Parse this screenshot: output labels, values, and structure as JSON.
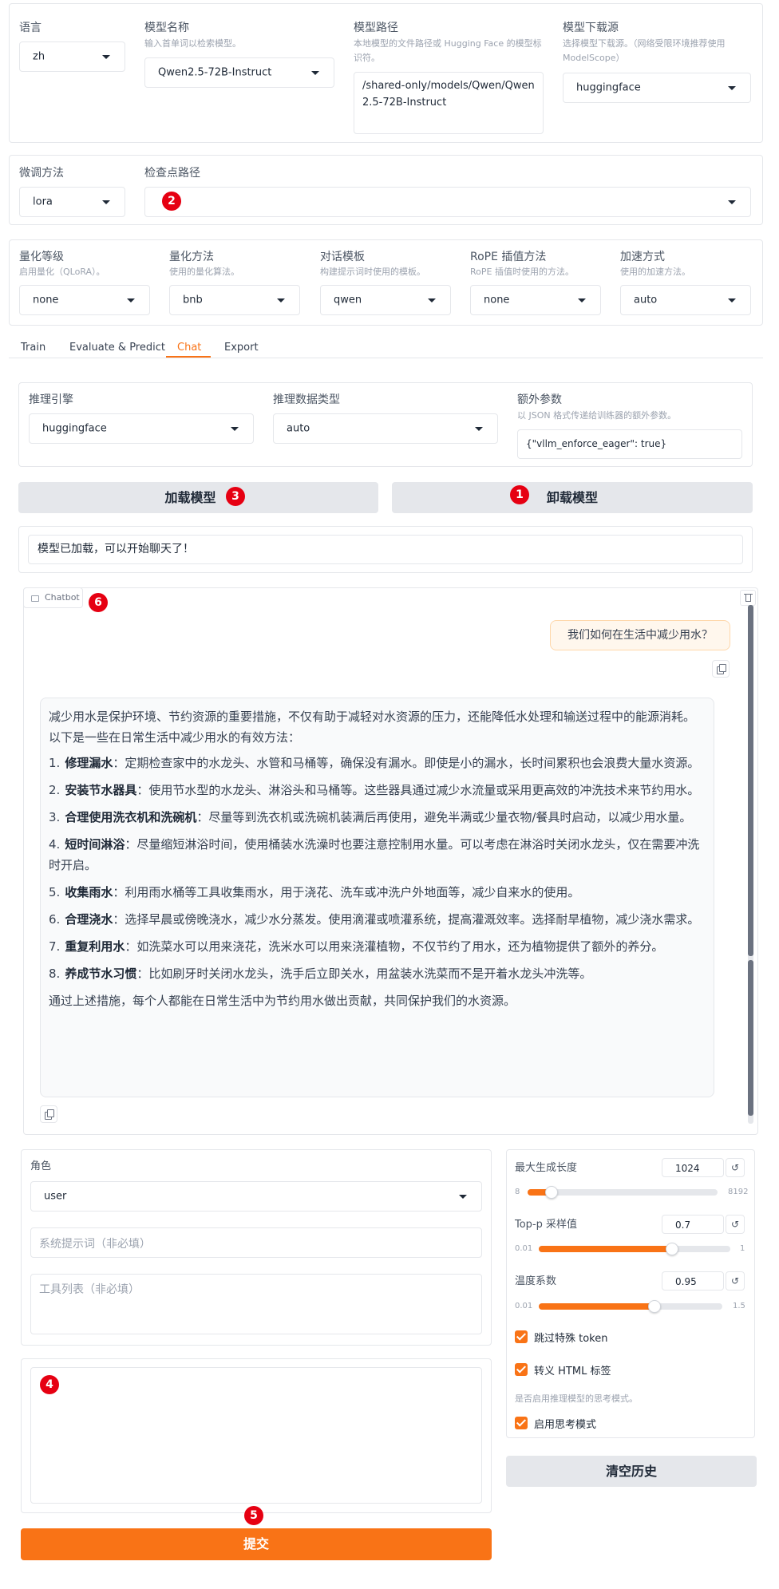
{
  "top_row": {
    "language": {
      "label": "语言",
      "value": "zh"
    },
    "model_name": {
      "label": "模型名称",
      "info": "输入首单词以检索模型。",
      "value": "Qwen2.5-72B-Instruct"
    },
    "model_path": {
      "label": "模型路径",
      "info": "本地模型的文件路径或 Hugging Face 的模型标识符。",
      "value": "/shared-only/models/Qwen/Qwen2.5-72B-Instruct"
    },
    "hub": {
      "label": "模型下载源",
      "info": "选择模型下载源。（网络受限环境推荐使用 ModelScope）",
      "value": "huggingface"
    }
  },
  "finetune_row": {
    "method": {
      "label": "微调方法",
      "value": "lora"
    },
    "checkpoint": {
      "label": "检查点路径",
      "value": ""
    }
  },
  "quant_row": {
    "quant_bit": {
      "label": "量化等级",
      "info": "启用量化（QLoRA）。",
      "value": "none"
    },
    "quant_method": {
      "label": "量化方法",
      "info": "使用的量化算法。",
      "value": "bnb"
    },
    "template": {
      "label": "对话模板",
      "info": "构建提示词时使用的模板。",
      "value": "qwen"
    },
    "rope": {
      "label": "RoPE 插值方法",
      "info": "RoPE 插值时使用的方法。",
      "value": "none"
    },
    "booster": {
      "label": "加速方式",
      "info": "使用的加速方法。",
      "value": "auto"
    }
  },
  "tabs": [
    {
      "label": "Train",
      "active": false
    },
    {
      "label": "Evaluate & Predict",
      "active": false
    },
    {
      "label": "Chat",
      "active": true
    },
    {
      "label": "Export",
      "active": false
    }
  ],
  "infer": {
    "backend": {
      "label": "推理引擎",
      "value": "huggingface"
    },
    "dtype": {
      "label": "推理数据类型",
      "value": "auto"
    },
    "extra_args": {
      "label": "额外参数",
      "info": "以 JSON 格式传递给训练器的额外参数。",
      "value": "{\"vllm_enforce_eager\": true}"
    }
  },
  "buttons": {
    "load": "加载模型",
    "unload": "卸载模型",
    "clear": "清空历史",
    "submit": "提交"
  },
  "status": "模型已加载，可以开始聊天了！",
  "chatbot": {
    "label": "Chatbot",
    "user_message": "我们如何在生活中减少用水？",
    "bot_intro": "减少用水是保护环境、节约资源的重要措施，不仅有助于减轻对水资源的压力，还能降低水处理和输送过程中的能源消耗。以下是一些在日常生活中减少用水的有效方法：",
    "bot_items": [
      {
        "n": "1.",
        "bold": "修理漏水",
        "text": "：定期检查家中的水龙头、水管和马桶等，确保没有漏水。即使是小的漏水，长时间累积也会浪费大量水资源。"
      },
      {
        "n": "2.",
        "bold": "安装节水器具",
        "text": "：使用节水型的水龙头、淋浴头和马桶等。这些器具通过减少水流量或采用更高效的冲洗技术来节约用水。"
      },
      {
        "n": "3.",
        "bold": "合理使用洗衣机和洗碗机",
        "text": "：尽量等到洗衣机或洗碗机装满后再使用，避免半满或少量衣物/餐具时启动，以减少用水量。"
      },
      {
        "n": "4.",
        "bold": "短时间淋浴",
        "text": "：尽量缩短淋浴时间，使用桶装水洗澡时也要注意控制用水量。可以考虑在淋浴时关闭水龙头，仅在需要冲洗时开启。"
      },
      {
        "n": "5.",
        "bold": "收集雨水",
        "text": "：利用雨水桶等工具收集雨水，用于浇花、洗车或冲洗户外地面等，减少自来水的使用。"
      },
      {
        "n": "6.",
        "bold": "合理浇水",
        "text": "：选择早晨或傍晚浇水，减少水分蒸发。使用滴灌或喷灌系统，提高灌溉效率。选择耐旱植物，减少浇水需求。"
      },
      {
        "n": "7.",
        "bold": "重复利用水",
        "text": "：如洗菜水可以用来浇花，洗米水可以用来浇灌植物，不仅节约了用水，还为植物提供了额外的养分。"
      },
      {
        "n": "8.",
        "bold": "养成节水习惯",
        "text": "：比如刷牙时关闭水龙头，洗手后立即关水，用盆装水洗菜而不是开着水龙头冲洗等。"
      }
    ],
    "bot_outro": "通过上述措施，每个人都能在日常生活中为节约用水做出贡献，共同保护我们的水资源。"
  },
  "left_panel": {
    "role": {
      "label": "角色",
      "value": "user"
    },
    "system_placeholder": "系统提示词（非必填）",
    "tools_placeholder": "工具列表（非必填）"
  },
  "right_panel": {
    "max_new_tokens": {
      "label": "最大生成长度",
      "value": "1024",
      "min": "8",
      "max": "8192",
      "fraction": 0.124
    },
    "top_p": {
      "label": "Top-p 采样值",
      "value": "0.7",
      "min": "0.01",
      "max": "1",
      "fraction": 0.697
    },
    "temperature": {
      "label": "温度系数",
      "value": "0.95",
      "min": "0.01",
      "max": "1.5",
      "fraction": 0.631
    },
    "skip_special": "跳过特殊 token",
    "escape_html": "转义 HTML 标签",
    "thinking_info": "是否启用推理模型的思考模式。",
    "enable_thinking": "启用思考模式",
    "reset_glyph": "↺"
  },
  "badges": [
    "1",
    "2",
    "3",
    "4",
    "5",
    "6"
  ],
  "colors": {
    "accent": "#f97316",
    "badge": "#e60012",
    "border": "#e5e7eb"
  }
}
